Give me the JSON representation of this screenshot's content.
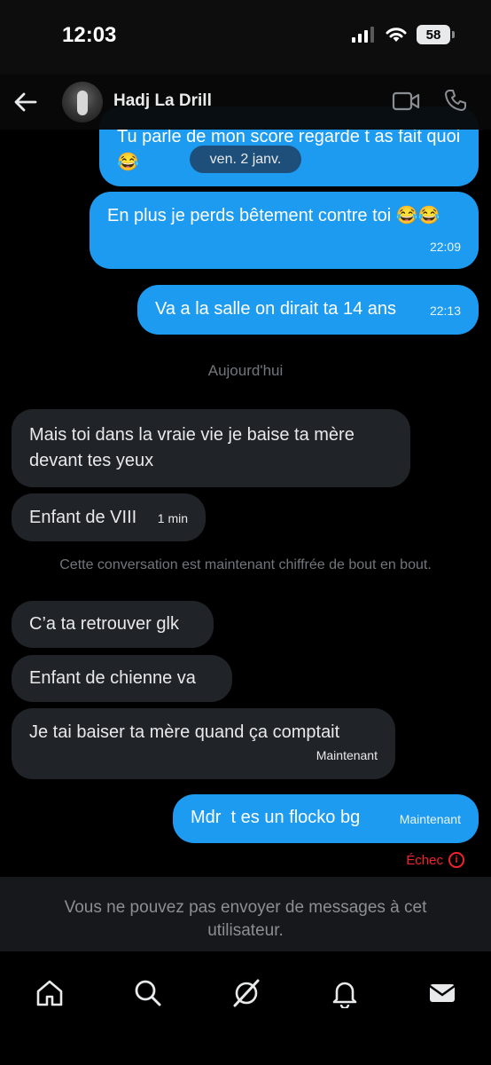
{
  "status_bar": {
    "time": "12:03",
    "battery": "58"
  },
  "header": {
    "contact_name": "Hadj La Drill"
  },
  "date_pill": "ven. 2 janv.",
  "messages": [
    {
      "text": "Tu parle de mon score regarde t as fait quoi 😂",
      "time": ""
    },
    {
      "text": "En plus je perds bêtement contre toi 😂😂",
      "time": "22:09"
    },
    {
      "text": "Va a la salle on dirait ta 14 ans",
      "time": "22:13"
    },
    {
      "text": "Mais toi dans la vraie vie je baise ta mère devant tes yeux",
      "time": ""
    },
    {
      "text": "Enfant de VIII",
      "time": "1 min"
    },
    {
      "text": "C’a ta retrouver glk",
      "time": ""
    },
    {
      "text": "Enfant de chienne va",
      "time": ""
    },
    {
      "text": "Je tai baiser ta mère quand ça comptait",
      "time": "Maintenant"
    },
    {
      "text": "Mdr  t es un flocko bg",
      "time": "Maintenant"
    }
  ],
  "today_label": "Aujourd'hui",
  "encryption_notice": "Cette conversation est maintenant chiffrée de bout en bout.",
  "failed_label": "Échec",
  "cant_send_notice": "Vous ne pouvez pas envoyer de messages à cet utilisateur.",
  "tabs": [
    "home-icon",
    "search-icon",
    "grok-icon",
    "notifications-icon",
    "messages-icon"
  ],
  "colors": {
    "sent_bubble": "#1d9bf0",
    "received_bubble": "#202327",
    "error": "#f4212e"
  }
}
